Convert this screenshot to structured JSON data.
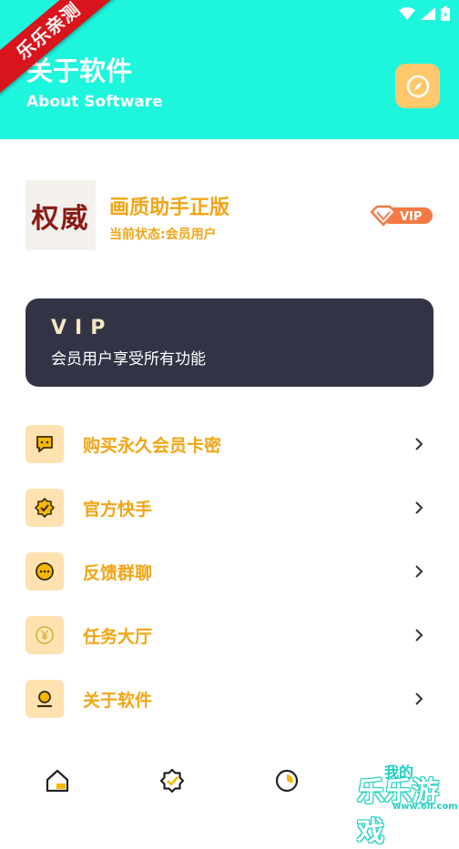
{
  "header": {
    "title": "关于软件",
    "subtitle": "About Software",
    "bg_color": "#1ef5dd"
  },
  "ribbon": {
    "text": "乐乐亲测"
  },
  "app": {
    "logo_text": "权威",
    "name": "画质助手正版",
    "status": "当前状态:会员用户",
    "badge": "VIP"
  },
  "vip_card": {
    "title": "VIP",
    "subtitle": "会员用户享受所有功能"
  },
  "menu": [
    {
      "label": "购买永久会员卡密",
      "icon": "chat-bubble-icon"
    },
    {
      "label": "官方快手",
      "icon": "badge-check-icon"
    },
    {
      "label": "反馈群聊",
      "icon": "smile-chat-icon"
    },
    {
      "label": "任务大厅",
      "icon": "yen-coin-icon"
    },
    {
      "label": "关于软件",
      "icon": "user-icon"
    }
  ],
  "tabbar": {
    "mine_label": "我的",
    "icons": [
      "home-icon",
      "badge-icon",
      "pie-chart-icon",
      "profile-icon"
    ]
  },
  "watermark": {
    "text": "乐乐游戏",
    "url": "www.6ll.com"
  },
  "colors": {
    "accent": "#f2a516",
    "teal": "#1ef5dd",
    "card_dark": "#323446"
  }
}
